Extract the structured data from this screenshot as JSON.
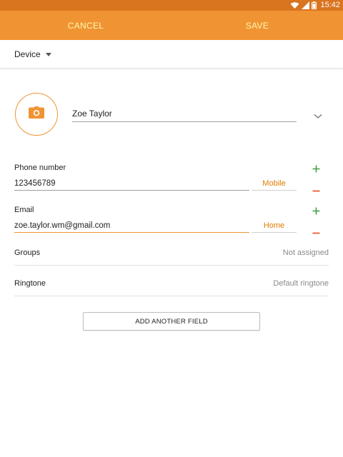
{
  "status_bar": {
    "time": "15:42",
    "icons": [
      "wifi-icon",
      "signal-icon",
      "battery-icon"
    ]
  },
  "app_bar": {
    "cancel_label": "CANCEL",
    "save_label": "SAVE"
  },
  "account": {
    "label": "Device"
  },
  "contact": {
    "photo_icon": "camera-icon",
    "name": "Zoe Taylor"
  },
  "phone": {
    "label": "Phone number",
    "value": "123456789",
    "type": "Mobile"
  },
  "email": {
    "label": "Email",
    "value": "zoe.taylor.wm@gmail.com",
    "type": "Home"
  },
  "groups": {
    "label": "Groups",
    "value": "Not assigned"
  },
  "ringtone": {
    "label": "Ringtone",
    "value": "Default ringtone"
  },
  "add_field_label": "ADD ANOTHER FIELD",
  "colors": {
    "status_bar": "#d9741f",
    "app_bar": "#f09433",
    "app_bar_text": "#fff8b0",
    "accent": "#f09433",
    "type_text": "#e07b00",
    "plus": "#43a047",
    "minus": "#e64a19"
  }
}
